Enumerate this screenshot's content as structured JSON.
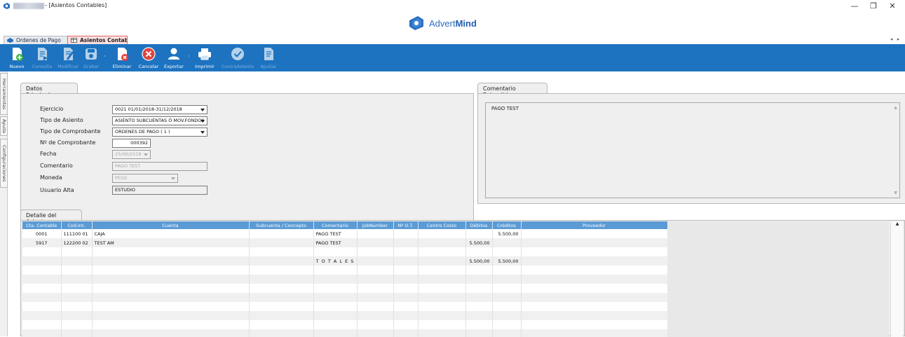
{
  "window": {
    "title_suffix": " - [Asientos Contables]",
    "controls": {
      "minimize": "—",
      "maximize": "❐",
      "close": "✕"
    }
  },
  "logo": {
    "text_light": "Advert",
    "text_bold": "Mind",
    "color": "#2a6fbe"
  },
  "doc_tabs": [
    {
      "label": "Ordenes de Pago",
      "active": false
    },
    {
      "label": "Asientos Contables",
      "active": true
    }
  ],
  "tab_arrows": "◂ ▸",
  "toolbar": {
    "background": "#1d73c0",
    "buttons": [
      {
        "id": "nuevo",
        "label": "Nuevo",
        "icon": "new-doc-icon",
        "enabled": true
      },
      {
        "id": "consulta",
        "label": "Consulta",
        "icon": "view-doc-icon",
        "enabled": false
      },
      {
        "id": "modificar",
        "label": "Modificar",
        "icon": "edit-doc-icon",
        "enabled": false
      },
      {
        "id": "grabar",
        "label": "Grabar",
        "icon": "save-icon",
        "enabled": false
      },
      {
        "id": "eliminar",
        "label": "Eliminar",
        "icon": "delete-doc-icon",
        "enabled": true
      },
      {
        "id": "cancelar",
        "label": "Cancelar",
        "icon": "cancel-icon",
        "enabled": true
      },
      {
        "id": "exportar",
        "label": "Exportar",
        "icon": "user-export-icon",
        "enabled": true
      },
      {
        "id": "imprimir",
        "label": "Imprimir",
        "icon": "printer-icon",
        "enabled": true
      },
      {
        "id": "contrasiento",
        "label": "ContraAsiento",
        "icon": "check-icon",
        "enabled": false
      },
      {
        "id": "ajustar",
        "label": "Ajustar",
        "icon": "adjust-doc-icon",
        "enabled": false
      }
    ]
  },
  "side_tabs": [
    "Herramientas",
    "Ayuda",
    "Configuraciones"
  ],
  "datos_principales": {
    "tab_label": "Datos Principales",
    "fields": {
      "ejercicio": {
        "label": "Ejercicio",
        "value": "0021 01/01/2018-31/12/2018"
      },
      "tipo_asiento": {
        "label": "Tipo de Asiento",
        "value": "ASIENTO SUBCUENTAS Ó MOV.FONDOS"
      },
      "tipo_comprobante": {
        "label": "Tipo de Comprobante",
        "value": "ORDENES DE PAGO ( 1 )"
      },
      "nro_comprobante": {
        "label": "Nº de Comprobante",
        "value": "000392"
      },
      "fecha": {
        "label": "Fecha",
        "value": "25/06/2018"
      },
      "comentario": {
        "label": "Comentario",
        "value": "PAGO TEST"
      },
      "moneda": {
        "label": "Moneda",
        "value": "PESO"
      },
      "usuario_alta": {
        "label": "Usuario Alta",
        "value": "ESTUDIO"
      }
    }
  },
  "comentario_extendido": {
    "tab_label": "Comentario Extendido",
    "value": "PAGO TEST"
  },
  "detalle": {
    "tab_label": "Detalle del Asiento",
    "columns": [
      "Cta. Contable",
      "Cod.Int.",
      "Cuenta",
      "Subcuenta / Concepto",
      "Comentario",
      "JobNumber",
      "Nº O.T.",
      "Centro Costo",
      "Débitos",
      "Créditos",
      "Proveedor"
    ],
    "rows": [
      [
        "0001",
        "111100 01",
        "CAJA",
        "",
        "PAGO TEST",
        "",
        "",
        "",
        "",
        "5.500,00",
        ""
      ],
      [
        "5917",
        "122200 02",
        "TEST AM",
        "",
        "PAGO TEST",
        "",
        "",
        "",
        "5.500,00",
        "",
        ""
      ],
      [
        "",
        "",
        "",
        "",
        "",
        "",
        "",
        "",
        "",
        "",
        ""
      ],
      [
        "",
        "",
        "",
        "",
        "T O T A L E S",
        "",
        "",
        "",
        "5.500,00",
        "5.500,00",
        ""
      ]
    ],
    "empty_rows": 8
  },
  "colors": {
    "grid_header": "#5b9bd5",
    "active_tab": "#ffe0e0"
  }
}
